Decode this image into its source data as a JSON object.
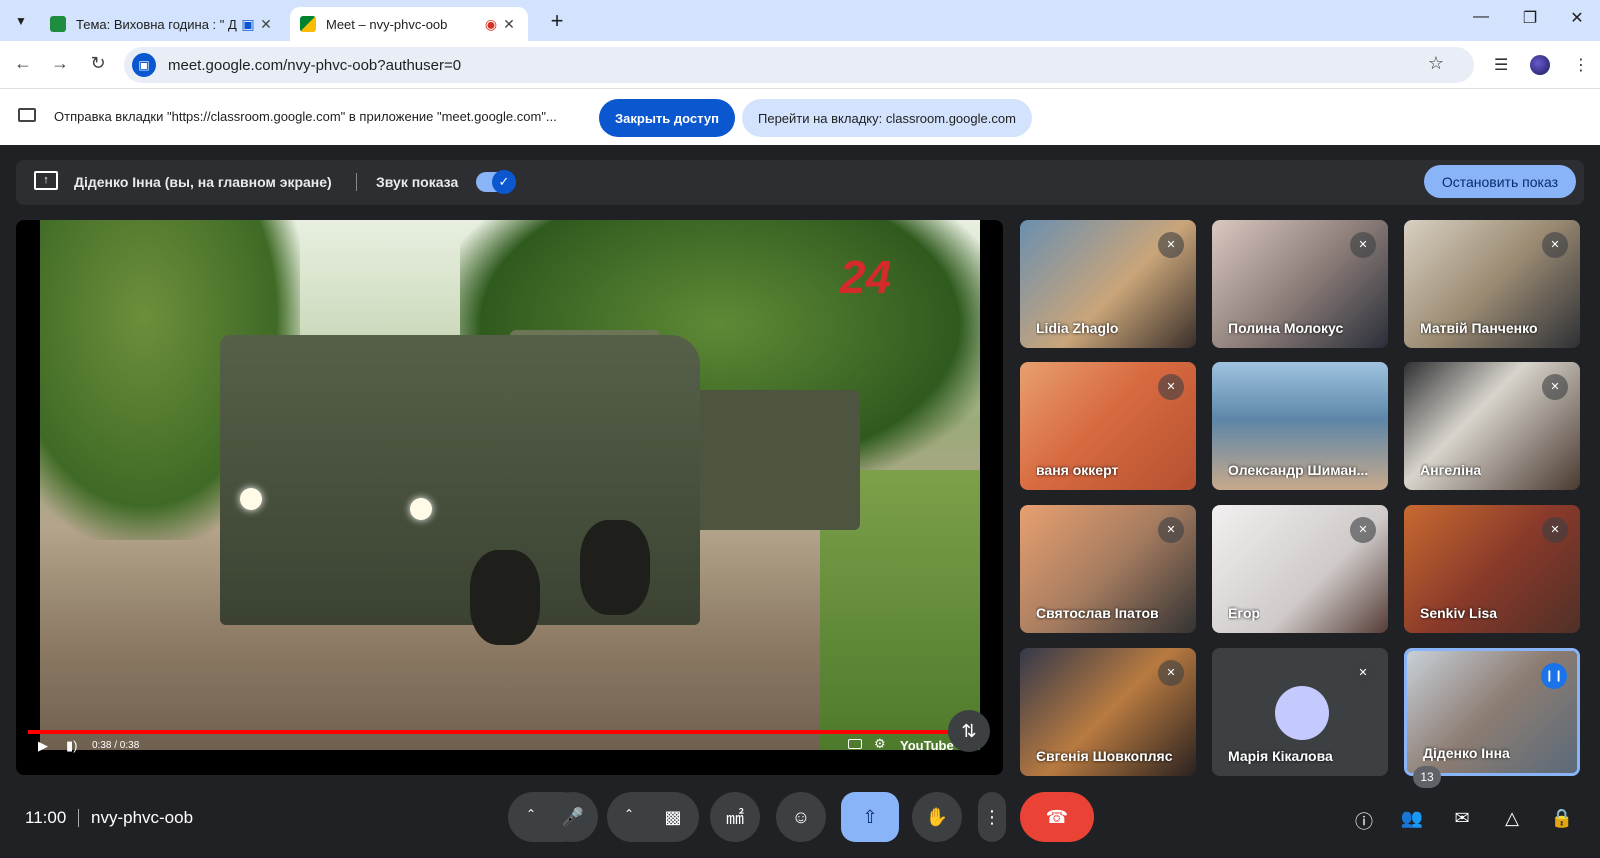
{
  "browser": {
    "tabs": [
      {
        "title": "Тема: Виховна година : \" Д",
        "active": false
      },
      {
        "title": "Meet – nvy-phvc-oob",
        "active": true
      }
    ],
    "url": "meet.google.com/nvy-phvc-oob?authuser=0",
    "infobar": {
      "text": "Отправка вкладки \"https://classroom.google.com\" в приложение \"meet.google.com\"...",
      "stop_access": "Закрыть доступ",
      "go_to_tab": "Перейти на вкладку: classroom.google.com"
    }
  },
  "sharebar": {
    "presenter": "Діденко Інна (вы, на главном экране)",
    "audio_label": "Звук показа",
    "audio_on": true,
    "stop_button": "Остановить показ"
  },
  "video": {
    "channel_logo": "24",
    "time": "0:38 / 0:38",
    "player": "YouTube",
    "progress_fraction": 1.0
  },
  "participants": [
    {
      "name": "Lidia Zhaglo",
      "muted": true
    },
    {
      "name": "Полина Молокус",
      "muted": true
    },
    {
      "name": "Матвій Панченко",
      "muted": true
    },
    {
      "name": "ваня оккерт",
      "muted": true
    },
    {
      "name": "Олександр Шиман...",
      "muted": false
    },
    {
      "name": "Ангеліна",
      "muted": true
    },
    {
      "name": "Святослав Іпатов",
      "muted": true
    },
    {
      "name": "Егор",
      "muted": true
    },
    {
      "name": "Senkiv Lisa",
      "muted": true
    },
    {
      "name": "Євгенія Шовкопляс",
      "muted": true
    },
    {
      "name": "Марія Кікалова",
      "muted": true
    },
    {
      "name": "Діденко Інна",
      "muted": false,
      "speaking": true
    }
  ],
  "bottom": {
    "time": "11:00",
    "meeting_code": "nvy-phvc-oob",
    "participants_count": "13"
  }
}
